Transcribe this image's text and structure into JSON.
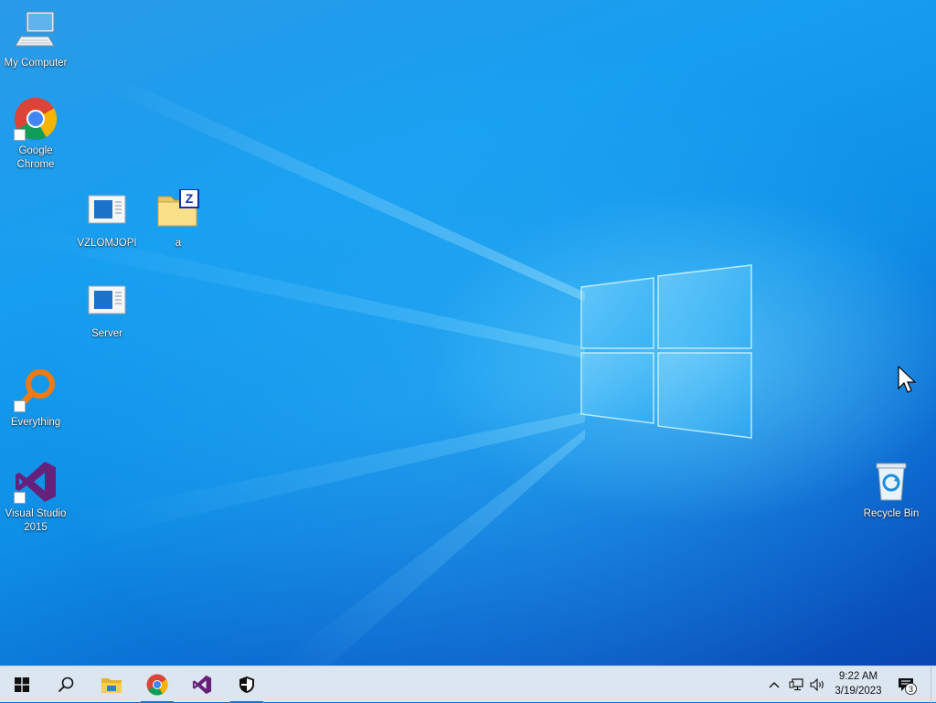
{
  "desktop_icons": {
    "my_computer": "My Computer",
    "google_chrome": "Google Chrome",
    "vzlomjopi": "VZLOMJOPI",
    "archive_a": "a",
    "server": "Server",
    "everything": "Everything",
    "visual_studio": "Visual Studio 2015",
    "recycle_bin": "Recycle Bin"
  },
  "taskbar": {
    "pinned": [
      {
        "name": "start-button",
        "icon": "windows-logo-icon"
      },
      {
        "name": "search-button",
        "icon": "search-icon"
      },
      {
        "name": "file-explorer",
        "icon": "folder-icon"
      },
      {
        "name": "google-chrome",
        "icon": "chrome-icon",
        "active": true
      },
      {
        "name": "visual-studio",
        "icon": "visual-studio-icon"
      },
      {
        "name": "security",
        "icon": "shield-icon",
        "active": true
      }
    ],
    "tray": {
      "icons": [
        "chevron-up-icon",
        "network-icon",
        "volume-icon"
      ],
      "time": "9:22 AM",
      "date": "3/19/2023",
      "notification_count": "3"
    }
  },
  "colors": {
    "wallpaper_blue": "#0e8ee6",
    "taskbar": "#dce6f0",
    "accent": "#1a73c9"
  }
}
